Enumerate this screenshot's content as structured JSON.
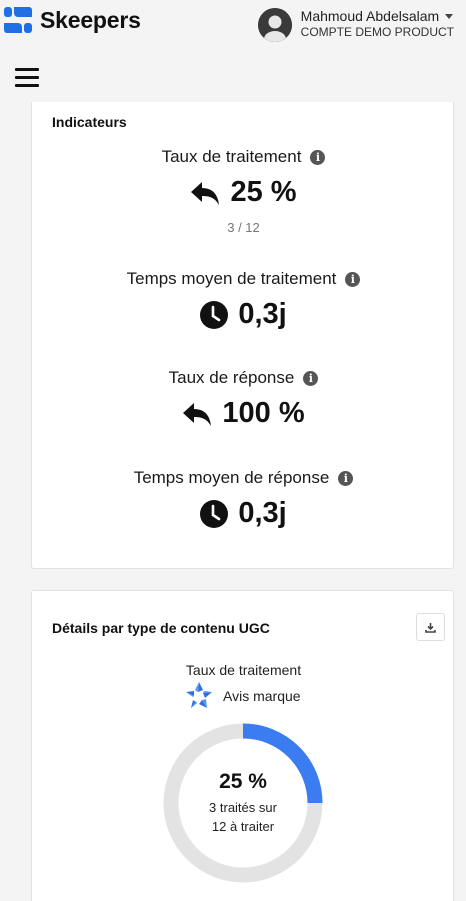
{
  "header": {
    "brand": "Skeepers",
    "user_name": "Mahmoud Abdelsalam",
    "user_account": "COMPTE DEMO PRODUCT"
  },
  "indicators": {
    "title": "Indicateurs",
    "metrics": [
      {
        "label": "Taux de traitement",
        "value": "25 %",
        "sub": "3 / 12",
        "icon": "reply-icon"
      },
      {
        "label": "Temps moyen de traitement",
        "value": "0,3j",
        "icon": "clock-icon"
      },
      {
        "label": "Taux de réponse",
        "value": "100 %",
        "icon": "reply-icon"
      },
      {
        "label": "Temps moyen de réponse",
        "value": "0,3j",
        "icon": "clock-icon"
      }
    ]
  },
  "ugc": {
    "title": "Détails par type de contenu UGC",
    "metric_label": "Taux de traitement",
    "type_label": "Avis marque",
    "donut": {
      "percent_text": "25 %",
      "line1": "3 traités sur",
      "line2": "12 à traiter",
      "fraction": 0.25,
      "fill_color": "#3b7cf0",
      "track_color": "#e3e3e3"
    }
  },
  "colors": {
    "brand_blue": "#1f6fe5",
    "text": "#1a1a1a",
    "background": "#f4f4f4"
  }
}
